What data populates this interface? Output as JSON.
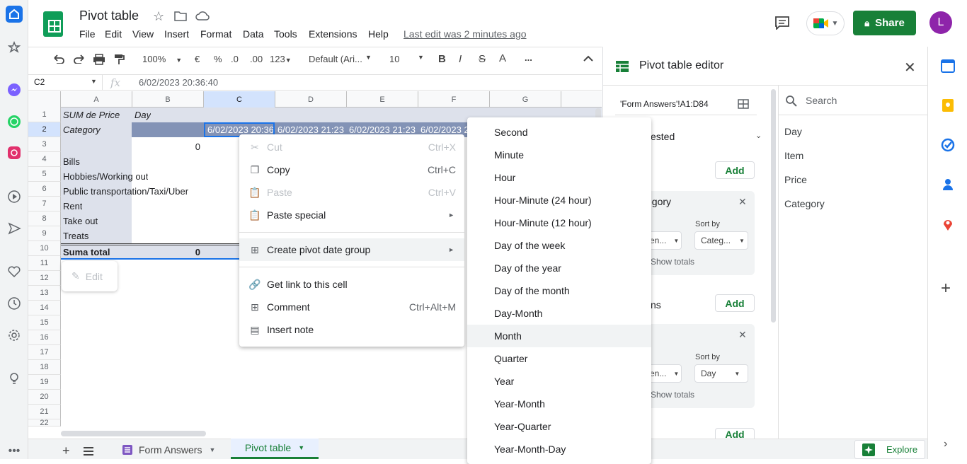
{
  "doc": {
    "title": "Pivot table",
    "last_edit": "Last edit was 2 minutes ago"
  },
  "menu": [
    "File",
    "Edit",
    "View",
    "Insert",
    "Format",
    "Data",
    "Tools",
    "Extensions",
    "Help"
  ],
  "header": {
    "share_label": "Share",
    "avatar_letter": "L"
  },
  "toolbar": {
    "zoom": "100%",
    "currency": "€",
    "percent": "%",
    "dec_dec": ".0",
    "inc_dec": ".00",
    "format_more": "123",
    "font": "Default (Ari...",
    "font_size": "10",
    "bold": "B",
    "italic": "I",
    "strike": "S",
    "text_color": "A",
    "more": "..."
  },
  "formula": {
    "cell_ref": "C2",
    "fx": "fx",
    "value": "6/02/2023 20:36:40"
  },
  "columns": [
    "A",
    "B",
    "C",
    "D",
    "E",
    "F",
    "G"
  ],
  "rows": [
    "1",
    "2",
    "3",
    "4",
    "5",
    "6",
    "7",
    "8",
    "9",
    "10",
    "11",
    "12",
    "13",
    "14",
    "15",
    "16",
    "17",
    "18",
    "19",
    "20",
    "21",
    "22"
  ],
  "cells": {
    "a1": "SUM de Price",
    "b1": "Day",
    "a2": "Category",
    "c2": "6/02/2023 20:36",
    "d2": "6/02/2023 21:23",
    "e2": "6/02/2023 21:23",
    "f2": "6/02/2023 2",
    "b3": "0",
    "a4": "Bills",
    "a5": "Hobbies/Working out",
    "a6": "Public transportation/Taxi/Uber",
    "a7": "Rent",
    "a8": "Take out",
    "a9": "Treats",
    "a10": "Suma total",
    "b10": "0",
    "edit": "Edit"
  },
  "context_menu": [
    {
      "label": "Cut",
      "shortcut": "Ctrl+X",
      "icon": "✂",
      "disabled": true
    },
    {
      "label": "Copy",
      "shortcut": "Ctrl+C",
      "icon": "❐",
      "disabled": false
    },
    {
      "label": "Paste",
      "shortcut": "Ctrl+V",
      "icon": "📋",
      "disabled": true
    },
    {
      "label": "Paste special",
      "shortcut": "►",
      "icon": "📋",
      "disabled": false
    },
    {
      "label": "Create pivot date group",
      "shortcut": "►",
      "icon": "⊞",
      "disabled": false
    },
    {
      "label": "Get link to this cell",
      "shortcut": "",
      "icon": "🔗",
      "disabled": false
    },
    {
      "label": "Comment",
      "shortcut": "Ctrl+Alt+M",
      "icon": "⊞",
      "disabled": false
    },
    {
      "label": "Insert note",
      "shortcut": "",
      "icon": "▤",
      "disabled": false
    }
  ],
  "submenu": [
    "Second",
    "Minute",
    "Hour",
    "Hour-Minute (24 hour)",
    "Hour-Minute (12 hour)",
    "Day of the week",
    "Day of the year",
    "Day of the month",
    "Day-Month",
    "Month",
    "Quarter",
    "Year",
    "Year-Month",
    "Year-Quarter",
    "Year-Month-Day"
  ],
  "submenu_highlight": "Month",
  "pivot": {
    "title": "Pivot table editor",
    "range": "'Form Answers'!A1:D84",
    "suggested": "ested",
    "add": "Add",
    "rows_field": "egory",
    "sort_by": "Sort by",
    "order1": "en...",
    "sortval1": "Categ...",
    "show_totals": "Show totals",
    "columns_section": "ns",
    "order2": "en...",
    "sortval2": "Day",
    "search_placeholder": "Search",
    "fields": [
      "Day",
      "Item",
      "Price",
      "Category"
    ]
  },
  "tabs": {
    "form_answers": "Form Answers",
    "pivot_table": "Pivot table",
    "explore": "Explore"
  },
  "colors": {
    "green": "#188038",
    "selection": "#1a73e8",
    "header_fill": "#d9dde8",
    "dark_fill": "#8393b6"
  }
}
